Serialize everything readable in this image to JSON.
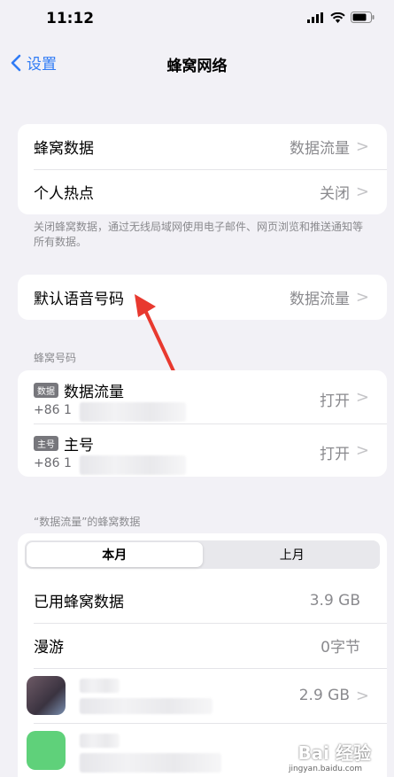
{
  "status": {
    "time": "11:12"
  },
  "nav": {
    "back_label": "设置",
    "title": "蜂窝网络"
  },
  "group1": {
    "cellular_data_label": "蜂窝数据",
    "cellular_data_value": "数据流量",
    "hotspot_label": "个人热点",
    "hotspot_value": "关闭"
  },
  "footnote": "关闭蜂窝数据，通过无线局域网使用电子邮件、网页浏览和推送通知等所有数据。",
  "group2": {
    "voice_label": "默认语音号码",
    "voice_value": "数据流量"
  },
  "sim_header": "蜂窝号码",
  "sims": [
    {
      "badge": "数据",
      "name": "数据流量",
      "number": "+86 1",
      "value": "打开"
    },
    {
      "badge": "主号",
      "name": "主号",
      "number": "+86 1",
      "value": "打开"
    }
  ],
  "usage_header": "“数据流量”的蜂窝数据",
  "segment": {
    "current": "本月",
    "last": "上月"
  },
  "usage": {
    "used_label": "已用蜂窝数据",
    "used_value": "3.9 GB",
    "roaming_label": "漫游",
    "roaming_value": "0字节",
    "app1_value": "2.9 GB"
  },
  "watermark": {
    "main": "Bai 经验",
    "sub": "jingyan.baidu.com"
  },
  "colors": {
    "accent": "#2f7bf5",
    "arrow": "#e8392f",
    "background": "#f2f1f6"
  }
}
